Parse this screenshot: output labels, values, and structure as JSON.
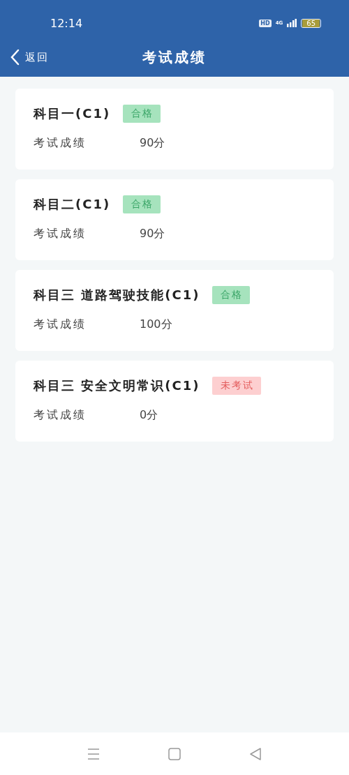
{
  "status_bar": {
    "time": "12:14",
    "hd": "HD",
    "network": "4G",
    "battery": "65"
  },
  "nav": {
    "back": "返回",
    "title": "考试成绩"
  },
  "results": [
    {
      "subject": "科目一(C1)",
      "status": {
        "label": "合格",
        "kind": "pass"
      },
      "score_label": "考试成绩",
      "score": "90分"
    },
    {
      "subject": "科目二(C1)",
      "status": {
        "label": "合格",
        "kind": "pass"
      },
      "score_label": "考试成绩",
      "score": "90分"
    },
    {
      "subject": "科目三 道路驾驶技能(C1)",
      "status": {
        "label": "合格",
        "kind": "pass"
      },
      "score_label": "考试成绩",
      "score": "100分"
    },
    {
      "subject": "科目三 安全文明常识(C1)",
      "status": {
        "label": "未考试",
        "kind": "not_taken"
      },
      "score_label": "考试成绩",
      "score": "0分"
    }
  ]
}
